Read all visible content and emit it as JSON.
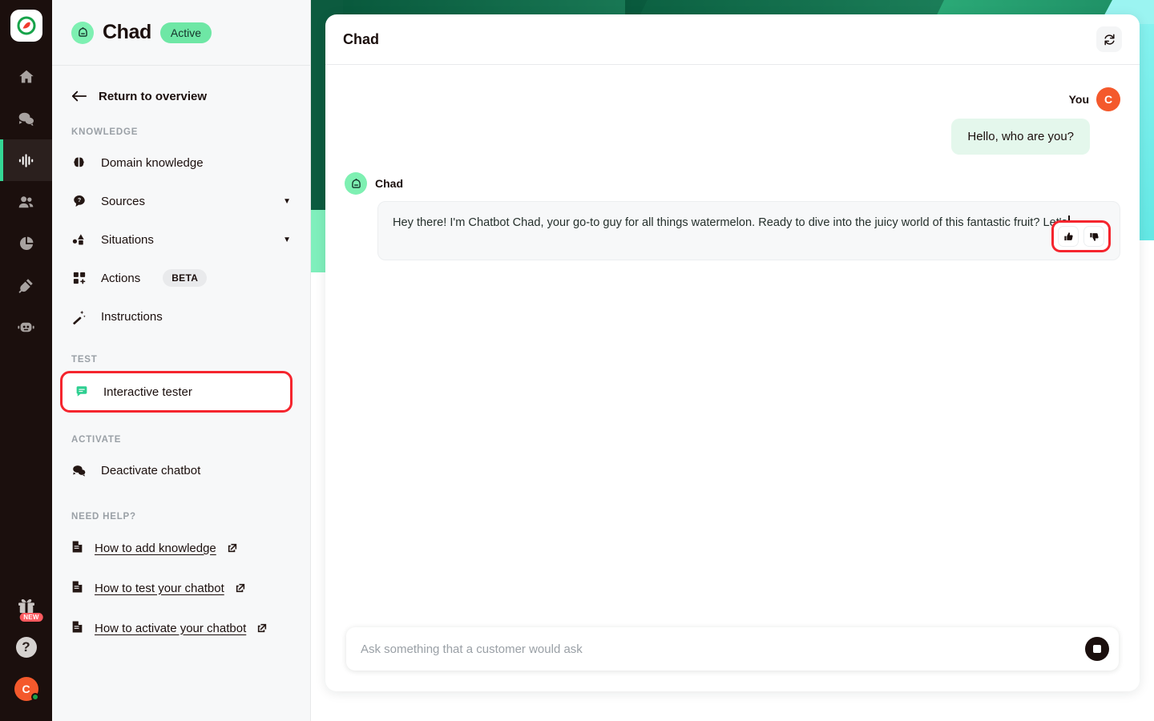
{
  "colors": {
    "accent_green": "#34d795",
    "badge_green": "#6ee7a5",
    "rail_bg": "#1b0f0d",
    "sidebar_bg": "#f7f8f9",
    "highlight_red": "#f5252e",
    "avatar_orange": "#f4592c",
    "deco_dark_green": "#0c5b3f",
    "deco_mid_green": "#2fbd80",
    "deco_cyan": "#79ecea"
  },
  "rail": {
    "logo_name": "app-logo",
    "items": [
      {
        "icon": "home-icon",
        "label": "Home",
        "active": false
      },
      {
        "icon": "chat-bubbles-icon",
        "label": "Conversations",
        "active": false
      },
      {
        "icon": "audio-waveform-icon",
        "label": "Chatbots",
        "active": true
      },
      {
        "icon": "users-icon",
        "label": "Contacts",
        "active": false
      },
      {
        "icon": "pie-chart-icon",
        "label": "Analytics",
        "active": false
      },
      {
        "icon": "plug-icon",
        "label": "Integrations",
        "active": false
      },
      {
        "icon": "robot-face-icon",
        "label": "Bots",
        "active": false
      }
    ],
    "bottom": [
      {
        "icon": "gift-icon",
        "label": "What's new",
        "badge": "NEW"
      },
      {
        "icon": "question-mark-icon",
        "label": "Help",
        "badge": ""
      },
      {
        "icon": "user-avatar",
        "label": "C",
        "badge": ""
      }
    ]
  },
  "sidebar": {
    "bot_name": "Chad",
    "status_badge": "Active",
    "bot_icon": "robot-head-icon",
    "return_link": "Return to overview",
    "back_icon": "arrow-left-icon",
    "sections": [
      {
        "label": "KNOWLEDGE",
        "items": [
          {
            "label": "Domain knowledge",
            "icon": "brain-icon",
            "caret": false,
            "tag": "",
            "highlight": false
          },
          {
            "label": "Sources",
            "icon": "question-bubble-icon",
            "caret": true,
            "tag": "",
            "highlight": false
          },
          {
            "label": "Situations",
            "icon": "shapes-icon",
            "caret": true,
            "tag": "",
            "highlight": false
          },
          {
            "label": "Actions",
            "icon": "grid-plus-icon",
            "caret": false,
            "tag": "BETA",
            "highlight": false
          },
          {
            "label": "Instructions",
            "icon": "magic-wand-icon",
            "caret": false,
            "tag": "",
            "highlight": false
          }
        ]
      },
      {
        "label": "TEST",
        "items": [
          {
            "label": "Interactive tester",
            "icon": "speech-bubble-icon",
            "caret": false,
            "tag": "",
            "highlight": true
          }
        ]
      },
      {
        "label": "ACTIVATE",
        "items": [
          {
            "label": "Deactivate chatbot",
            "icon": "chat-bubbles-icon",
            "caret": false,
            "tag": "",
            "highlight": false
          }
        ]
      }
    ],
    "help_section_label": "NEED HELP?",
    "help_links": [
      {
        "label": "How to add knowledge",
        "icon": "document-icon",
        "external_icon": "external-link-icon"
      },
      {
        "label": "How to test your chatbot",
        "icon": "document-icon",
        "external_icon": "external-link-icon"
      },
      {
        "label": "How to activate your chatbot",
        "icon": "document-icon",
        "external_icon": "external-link-icon"
      }
    ]
  },
  "chat": {
    "header_title": "Chad",
    "refresh_icon": "refresh-icon",
    "messages": [
      {
        "role": "user",
        "author": "You",
        "avatar_initial": "C",
        "text": "Hello, who are you?"
      },
      {
        "role": "bot",
        "author": "Chad",
        "avatar_icon": "robot-head-icon",
        "text": "Hey there!  I'm Chatbot Chad, your go-to guy for all things watermelon. Ready to dive into the juicy world of this fantastic fruit?  Let's",
        "streaming": true,
        "feedback": {
          "thumbs_up_icon": "thumbs-up-icon",
          "thumbs_down_icon": "thumbs-down-icon"
        }
      }
    ],
    "composer": {
      "placeholder": "Ask something that a customer would ask",
      "value": "",
      "send_icon": "stop-icon"
    }
  }
}
